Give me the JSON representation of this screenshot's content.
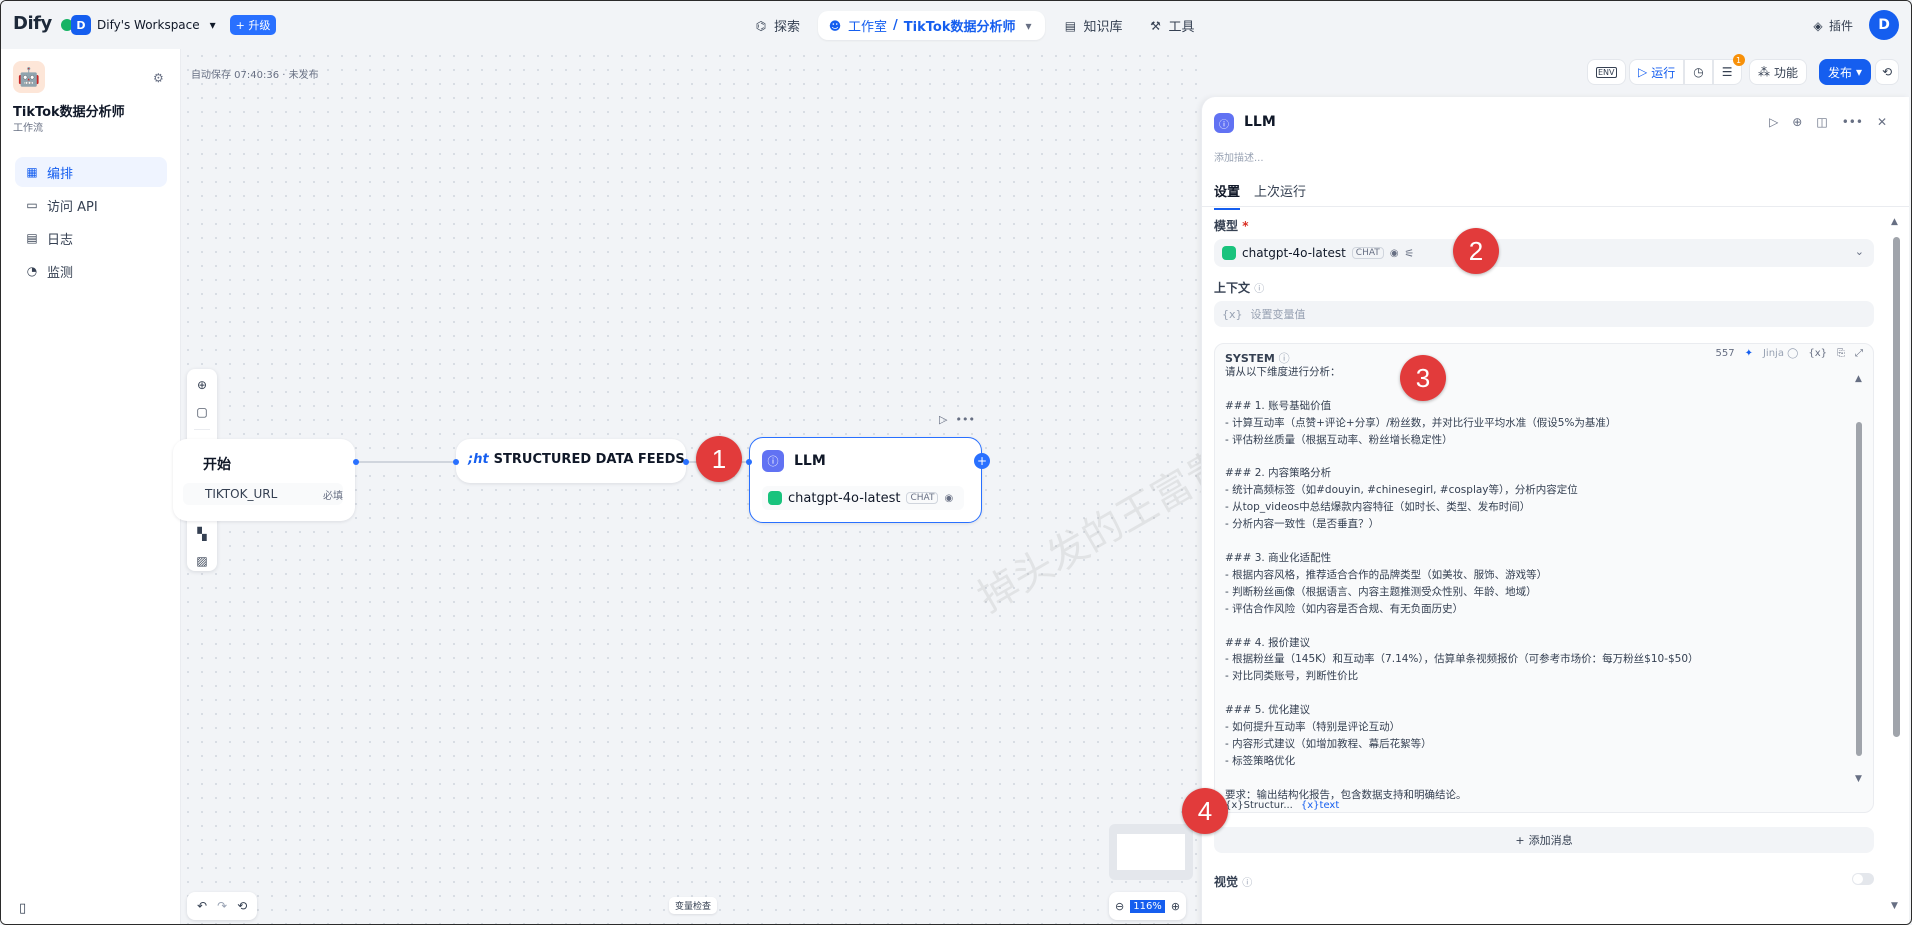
{
  "topbar": {
    "logo": "Dify",
    "workspace_avatar": "D",
    "workspace_name": "Dify's Workspace",
    "upgrade_label": "升级",
    "nav": {
      "explore": "探索",
      "studio": "工作室",
      "current_app": "TikTok数据分析师",
      "knowledge": "知识库",
      "tools": "工具"
    },
    "plugins_label": "插件",
    "user_avatar": "D"
  },
  "sidebar": {
    "app_name": "TikTok数据分析师",
    "app_type": "工作流",
    "items": [
      {
        "label": "编排",
        "icon": "orchestrate-icon"
      },
      {
        "label": "访问 API",
        "icon": "api-icon"
      },
      {
        "label": "日志",
        "icon": "log-icon"
      },
      {
        "label": "监测",
        "icon": "monitor-icon"
      }
    ]
  },
  "canvas": {
    "autosave": "自动保存 07:40:36 · 未发布",
    "start_node_title": "开始",
    "start_var": "TIKTOK_URL",
    "start_required": "必填",
    "sdf_node_title": "STRUCTURED DATA FEEDS",
    "llm_node_title": "LLM",
    "llm_model": "chatgpt-4o-latest",
    "llm_chip": "CHAT",
    "var_inspect": "变量检查",
    "zoom": "116%",
    "watermark": "掉头发的王富贵"
  },
  "header_actions": {
    "env": "ENV",
    "run": "运行",
    "feature": "功能",
    "publish": "发布",
    "badge": "1"
  },
  "panel": {
    "title": "LLM",
    "description_placeholder": "添加描述...",
    "tabs": [
      "设置",
      "上次运行"
    ],
    "model_label": "模型",
    "model_name": "chatgpt-4o-latest",
    "model_chip": "CHAT",
    "context_label": "上下文",
    "context_placeholder": "设置变量值",
    "system_label": "SYSTEM",
    "system_count": "557",
    "jinja": "Jinja",
    "system_prompt": "请从以下维度进行分析：\n\n### 1. 账号基础价值\n- 计算互动率（点赞+评论+分享）/粉丝数，并对比行业平均水准（假设5%为基准）\n- 评估粉丝质量（根据互动率、粉丝增长稳定性）\n\n### 2. 内容策略分析\n- 统计高频标签（如#douyin, #chinesegirl, #cosplay等），分析内容定位\n- 从top_videos中总结爆款内容特征（如时长、类型、发布时间）\n- 分析内容一致性（是否垂直？）\n\n### 3. 商业化适配性\n- 根据内容风格，推荐适合合作的品牌类型（如美妆、服饰、游戏等）\n- 判断粉丝画像（根据语言、内容主题推测受众性别、年龄、地域）\n- 评估合作风险（如内容是否合规、有无负面历史）\n\n### 4. 报价建议\n- 根据粉丝量（145K）和互动率（7.14%），估算单条视频报价（可参考市场价：每万粉丝$10-$50）\n- 对比同类账号，判断性价比\n\n### 5. 优化建议\n- 如何提升互动率（特别是评论互动）\n- 内容形式建议（如增加教程、幕后花絮等）\n- 标签策略优化\n\n要求：输出结构化报告，包含数据支持和明确结论。",
    "var_struct": "Structur...",
    "var_text": "text",
    "add_message": "添加消息",
    "vision_label": "视觉"
  },
  "markers": [
    "1",
    "2",
    "3",
    "4"
  ]
}
